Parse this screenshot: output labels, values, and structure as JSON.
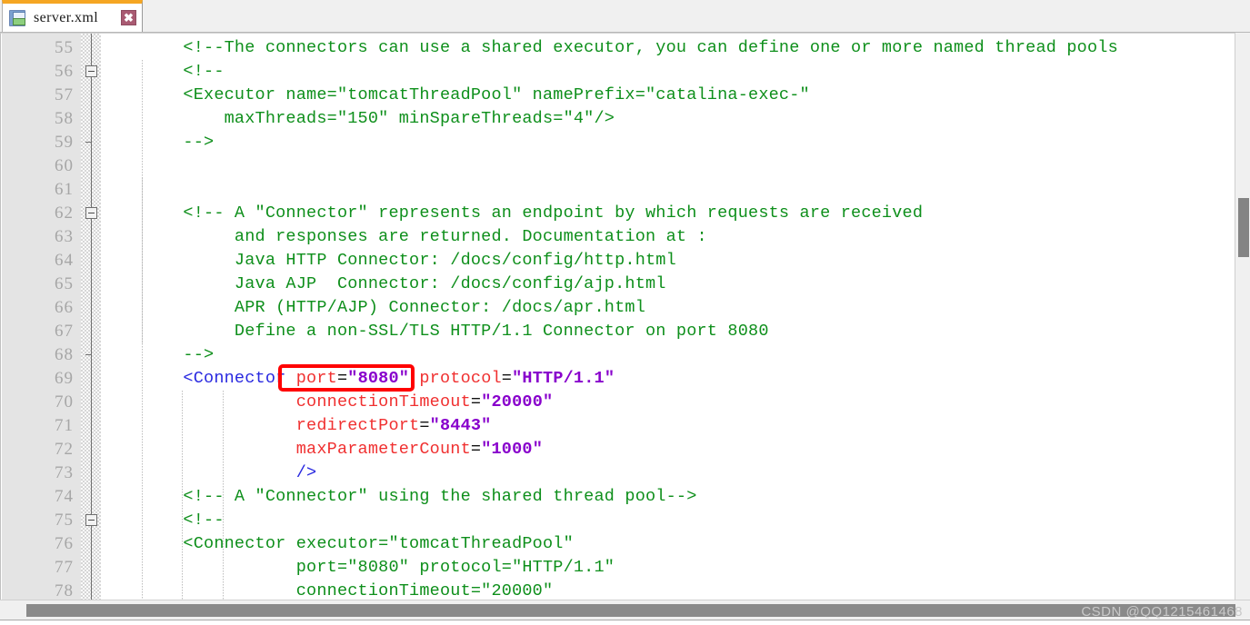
{
  "tab": {
    "label": "server.xml",
    "save_icon": "floppy-save-icon",
    "close_icon": "close-icon",
    "close_glyph": "✖",
    "accent_color": "#f5a623"
  },
  "editor": {
    "language": "xml",
    "first_visible_line": 55,
    "last_visible_line": 78,
    "colors": {
      "comment": "#0e8f1b",
      "tag": "#2929e0",
      "attribute": "#f03030",
      "value": "#8800cc",
      "gutter_bg": "#e4e4e4",
      "linenum": "#a6a6a6",
      "highlight": "#ff0000"
    },
    "lines": [
      {
        "n": 55,
        "tokens": [
          {
            "t": "cmt",
            "s": "        <!--The connectors can use a shared executor, you can define one or more named thread pools"
          }
        ]
      },
      {
        "n": 56,
        "tokens": [
          {
            "t": "cmt",
            "s": "        <!--"
          }
        ],
        "fold": "open"
      },
      {
        "n": 57,
        "tokens": [
          {
            "t": "cmt",
            "s": "        <Executor name=\"tomcatThreadPool\" namePrefix=\"catalina-exec-\""
          }
        ]
      },
      {
        "n": 58,
        "tokens": [
          {
            "t": "cmt",
            "s": "            maxThreads=\"150\" minSpareThreads=\"4\"/>"
          }
        ]
      },
      {
        "n": 59,
        "tokens": [
          {
            "t": "cmt",
            "s": "        -->"
          }
        ],
        "fold": "end"
      },
      {
        "n": 60,
        "tokens": []
      },
      {
        "n": 61,
        "tokens": []
      },
      {
        "n": 62,
        "tokens": [
          {
            "t": "cmt",
            "s": "        <!-- A \"Connector\" represents an endpoint by which requests are received"
          }
        ],
        "fold": "open"
      },
      {
        "n": 63,
        "tokens": [
          {
            "t": "cmt",
            "s": "             and responses are returned. Documentation at :"
          }
        ]
      },
      {
        "n": 64,
        "tokens": [
          {
            "t": "cmt",
            "s": "             Java HTTP Connector: /docs/config/http.html"
          }
        ]
      },
      {
        "n": 65,
        "tokens": [
          {
            "t": "cmt",
            "s": "             Java AJP  Connector: /docs/config/ajp.html"
          }
        ]
      },
      {
        "n": 66,
        "tokens": [
          {
            "t": "cmt",
            "s": "             APR (HTTP/AJP) Connector: /docs/apr.html"
          }
        ]
      },
      {
        "n": 67,
        "tokens": [
          {
            "t": "cmt",
            "s": "             Define a non-SSL/TLS HTTP/1.1 Connector on port 8080"
          }
        ]
      },
      {
        "n": 68,
        "tokens": [
          {
            "t": "cmt",
            "s": "        -->"
          }
        ],
        "fold": "end"
      },
      {
        "n": 69,
        "tokens": [
          {
            "t": "tag",
            "s": "        <Connector"
          },
          {
            "t": "attr",
            "s": " port"
          },
          {
            "t": "eq",
            "s": "="
          },
          {
            "t": "val",
            "s": "\"8080\""
          },
          {
            "t": "attr",
            "s": " protocol"
          },
          {
            "t": "eq",
            "s": "="
          },
          {
            "t": "val",
            "s": "\"HTTP/1.1\""
          }
        ]
      },
      {
        "n": 70,
        "tokens": [
          {
            "t": "attr",
            "s": "                   connectionTimeout"
          },
          {
            "t": "eq",
            "s": "="
          },
          {
            "t": "val",
            "s": "\"20000\""
          }
        ]
      },
      {
        "n": 71,
        "tokens": [
          {
            "t": "attr",
            "s": "                   redirectPort"
          },
          {
            "t": "eq",
            "s": "="
          },
          {
            "t": "val",
            "s": "\"8443\""
          }
        ]
      },
      {
        "n": 72,
        "tokens": [
          {
            "t": "attr",
            "s": "                   maxParameterCount"
          },
          {
            "t": "eq",
            "s": "="
          },
          {
            "t": "val",
            "s": "\"1000\""
          }
        ]
      },
      {
        "n": 73,
        "tokens": [
          {
            "t": "tag",
            "s": "                   />"
          }
        ]
      },
      {
        "n": 74,
        "tokens": [
          {
            "t": "cmt",
            "s": "        <!-- A \"Connector\" using the shared thread pool-->"
          }
        ]
      },
      {
        "n": 75,
        "tokens": [
          {
            "t": "cmt",
            "s": "        <!--"
          }
        ],
        "fold": "open"
      },
      {
        "n": 76,
        "tokens": [
          {
            "t": "cmt",
            "s": "        <Connector executor=\"tomcatThreadPool\""
          }
        ]
      },
      {
        "n": 77,
        "tokens": [
          {
            "t": "cmt",
            "s": "                   port=\"8080\" protocol=\"HTTP/1.1\""
          }
        ]
      },
      {
        "n": 78,
        "tokens": [
          {
            "t": "cmt",
            "s": "                   connectionTimeout=\"20000\""
          }
        ]
      }
    ],
    "highlight": {
      "target_text": "port=\"8080\"",
      "line": 69
    }
  },
  "scrollbars": {
    "vertical_thumb_name": "vertical-scrollbar-thumb",
    "horizontal_thumb_name": "horizontal-scrollbar-thumb"
  },
  "watermark": {
    "text": "CSDN @QQ1215461468"
  }
}
